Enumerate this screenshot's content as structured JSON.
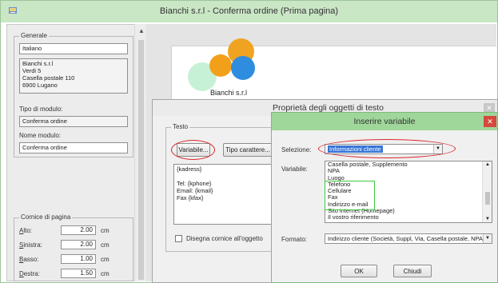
{
  "window": {
    "title": "Bianchi s.r.l - Conferma ordine (Prima pagina)"
  },
  "left_panel": {
    "group_generale": "Generale",
    "language": "Italiano",
    "address": "Bianchi s.r.l\nVerdi 5\nCasella postale 110\n6900 Lugano",
    "form_type_label": "Tipo di modulo:",
    "form_type_value": "Conferma ordine",
    "form_name_label": "Nome modulo:",
    "form_name_value": "Conferma ordine",
    "group_cornice": "Cornice di pagina",
    "margins": [
      {
        "label": "Alto:",
        "value": "2.00",
        "unit": "cm"
      },
      {
        "label": "Sinistra:",
        "value": "2.00",
        "unit": "cm"
      },
      {
        "label": "Basso:",
        "value": "1.00",
        "unit": "cm"
      },
      {
        "label": "Destra:",
        "value": "1.50",
        "unit": "cm"
      }
    ]
  },
  "preview": {
    "logo_text": "Bianchi s.r.l"
  },
  "props_dialog": {
    "title": "Proprietà degli oggetti di testo",
    "group_testo": "Testo",
    "btn_variabile": "Variabile...",
    "btn_tipo_carattere": "Tipo carattere...",
    "text_content": "{kadress}\n\nTel:    {kphone}\nEmail:  {kmail}\nFax     {kfax}",
    "checkbox_label": "Disegna cornice all'oggetto"
  },
  "insert_dialog": {
    "title": "Inserire variabile",
    "selezione_label": "Selezione:",
    "selezione_value": "Informazioni cliente",
    "variabile_label": "Variabile:",
    "variables": [
      "Casella postale, Supplemento",
      "NPA",
      "Luogo",
      "Telefono",
      "Cellulare",
      "Fax",
      "Indirizzo e-mail",
      "Sito internet (Homepage)",
      "Il vostro riferimento"
    ],
    "formato_label": "Formato:",
    "formato_value": "Indirizzo cliente (Società, Suppl, Via, Casella postale, NPA, Luogo)",
    "btn_ok": "OK",
    "btn_chiudi": "Chiudi"
  },
  "colors": {
    "main_titlebar": "#c9e6c5",
    "insert_titlebar": "#9fd69a",
    "close_red": "#d5493c",
    "highlight_red": "#d9282f",
    "highlight_green": "#3ec83e",
    "selection_blue": "#3875d7"
  }
}
